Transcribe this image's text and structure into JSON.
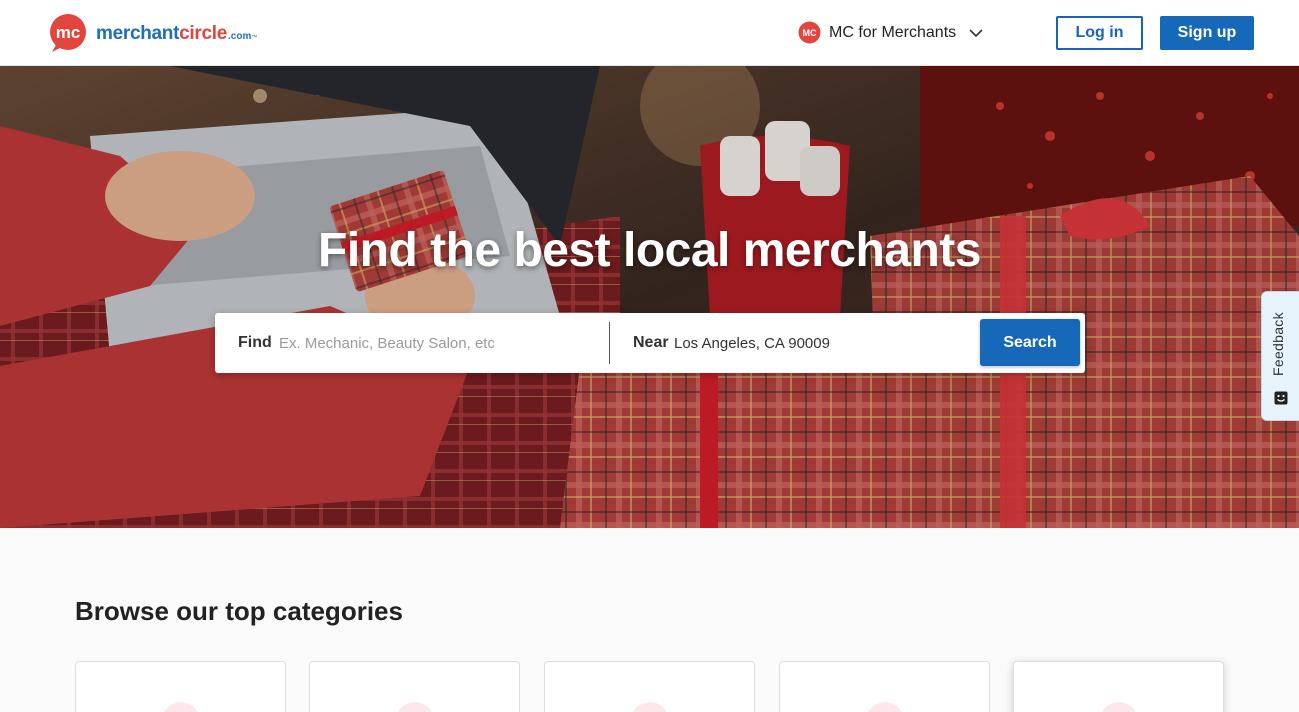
{
  "header": {
    "logo_badge": "mc",
    "logo_text_main": "merchant",
    "logo_text_accent": "circle",
    "logo_domain": ".com",
    "logo_tm": "™",
    "merchants_badge": "MC",
    "merchants_label": "MC for Merchants",
    "login_label": "Log in",
    "signup_label": "Sign up"
  },
  "hero": {
    "title": "Find the best local merchants",
    "find_label": "Find",
    "find_placeholder": "Ex. Mechanic, Beauty Salon, etc",
    "near_label": "Near",
    "near_value": "Los Angeles, CA 90009",
    "search_label": "Search"
  },
  "feedback": {
    "label": "Feedback"
  },
  "categories": {
    "title": "Browse our top categories",
    "cards": [
      "",
      "",
      "",
      "",
      ""
    ]
  },
  "colors": {
    "brand_blue": "#1669b8",
    "brand_red": "#e2453d",
    "text_dark": "#222222"
  },
  "icons": {
    "logo": "merchantcircle-logo",
    "merchants_badge": "mc-badge-icon",
    "chevron": "chevron-down-icon",
    "feedback": "smiley-icon"
  }
}
